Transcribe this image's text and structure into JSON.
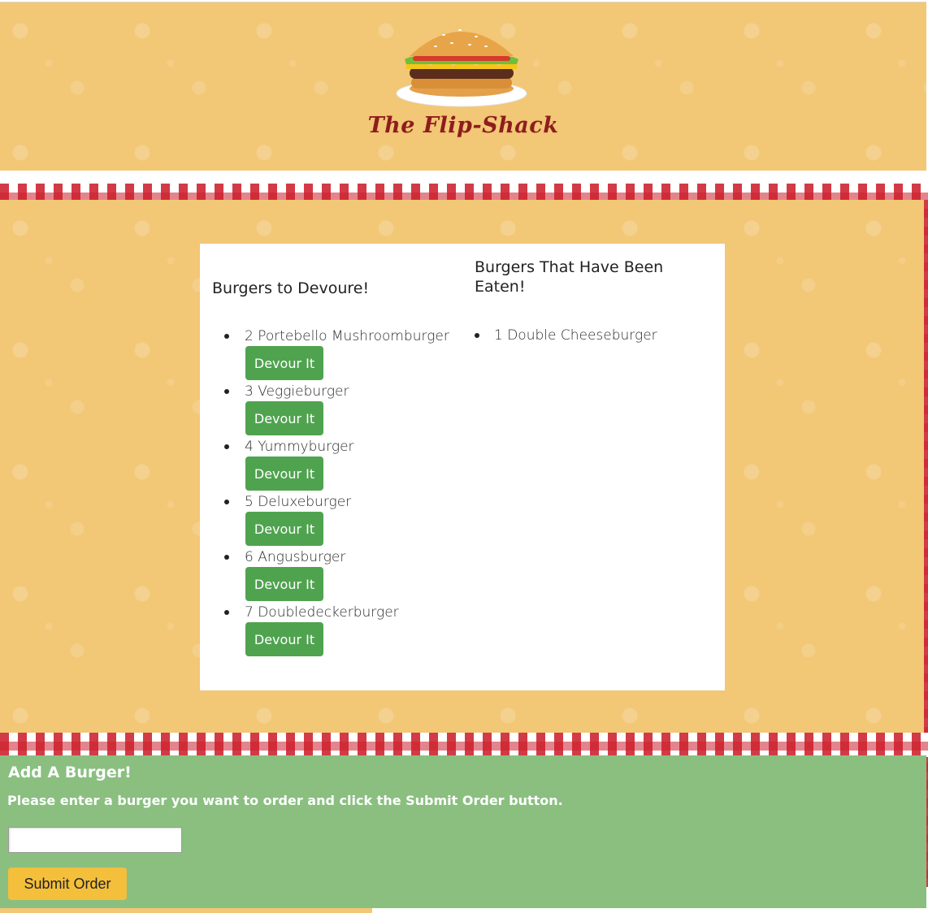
{
  "header": {
    "site_title": "The Flip-Shack",
    "logo_icon": "burger-logo-icon"
  },
  "devour_column": {
    "heading": "Burgers to Devoure!",
    "items": [
      {
        "label": "2 Portebello Mushroomburger",
        "button": "Devour It"
      },
      {
        "label": "3 Veggieburger",
        "button": "Devour It"
      },
      {
        "label": "4 Yummyburger",
        "button": "Devour It"
      },
      {
        "label": "5 Deluxeburger",
        "button": "Devour It"
      },
      {
        "label": "6 Angusburger",
        "button": "Devour It"
      },
      {
        "label": "7 Doubledeckerburger",
        "button": "Devour It"
      }
    ]
  },
  "eaten_column": {
    "heading": "Burgers That Have Been Eaten!",
    "items": [
      {
        "label": "1 Double Cheeseburger"
      }
    ]
  },
  "order_form": {
    "title": "Add A Burger!",
    "instructions": "Please enter a burger you want to order and click the Submit Order button.",
    "input_value": "",
    "submit_label": "Submit Order"
  },
  "colors": {
    "header_bg": "#f2c776",
    "title_color": "#8e1d1d",
    "devour_button": "#4fa34f",
    "form_bg": "#8abf80",
    "submit_button": "#f4bf3b",
    "checker_red": "#cc202d"
  }
}
